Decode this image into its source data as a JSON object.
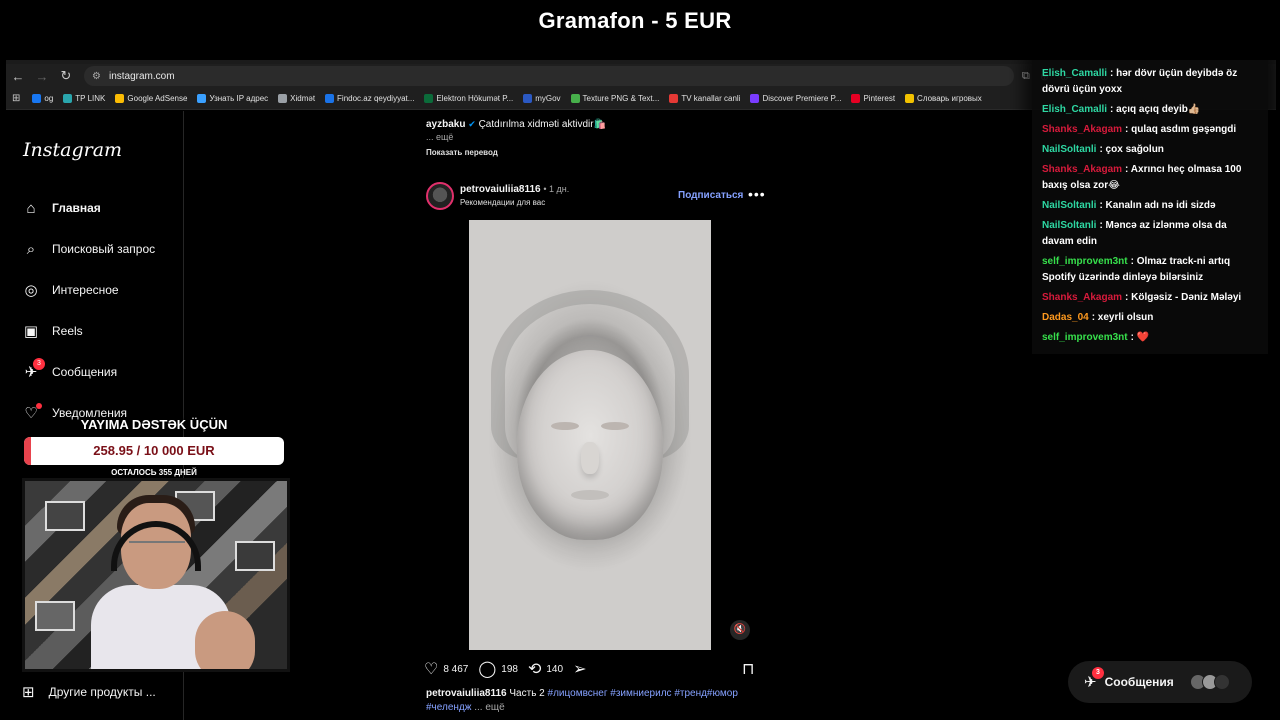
{
  "stream": {
    "title": "Gramafon - 5 EUR"
  },
  "browser": {
    "url": "instagram.com",
    "bookmarks": [
      {
        "label": "og",
        "color": "#1877f2"
      },
      {
        "label": "TP LINK",
        "color": "#2aa6ad"
      },
      {
        "label": "Google AdSense",
        "color": "#fbbc04"
      },
      {
        "label": "Узнать IP адрес",
        "color": "#3aa0ff"
      },
      {
        "label": "Xidmət",
        "color": "#9aa0a6"
      },
      {
        "label": "Findoc.az qeydiyyat...",
        "color": "#1a73e8"
      },
      {
        "label": "Elektron Hökumət P...",
        "color": "#0b6b3a"
      },
      {
        "label": "myGov",
        "color": "#2b59c3"
      },
      {
        "label": "Texture PNG & Text...",
        "color": "#47b04b"
      },
      {
        "label": "TV kanallar canli",
        "color": "#e53935"
      },
      {
        "label": "Discover Premiere P...",
        "color": "#7a3cff"
      },
      {
        "label": "Pinterest",
        "color": "#e60023"
      },
      {
        "label": "Словарь игровых",
        "color": "#f2c200"
      }
    ]
  },
  "sidebar": {
    "logo": "Instagram",
    "items": [
      {
        "label": "Главная",
        "icon": "home-icon",
        "glyph": "⌂"
      },
      {
        "label": "Поисковый запрос",
        "icon": "search-icon",
        "glyph": "⌕"
      },
      {
        "label": "Интересное",
        "icon": "compass-icon",
        "glyph": "◎"
      },
      {
        "label": "Reels",
        "icon": "reels-icon",
        "glyph": "▣"
      },
      {
        "label": "Сообщения",
        "icon": "messenger-icon",
        "glyph": "✈",
        "badge": "3"
      },
      {
        "label": "Уведомления",
        "icon": "heart-icon",
        "glyph": "♡"
      }
    ],
    "other_label": "Другие продукты ..."
  },
  "feed": {
    "prev_post": {
      "user": "ayzbaku",
      "caption": "Çatdırılma xidməti aktivdir🛍️",
      "more": "... ещё",
      "translate": "Показать перевод"
    },
    "post": {
      "user": "petrovaiuliia8116",
      "time": "• 1 дн.",
      "subtitle": "Рекомендации для вас",
      "follow": "Подписаться",
      "likes": "8 467",
      "comments": "198",
      "reposts": "140",
      "caption_user": "petrovaiuliia8116",
      "caption_text": "Часть 2",
      "tags_line1": "#лицомвснег #зимниерилс #тренд#юмор",
      "tags_line2": "#челендж",
      "caption_more": "... ещё"
    }
  },
  "messages_pill": {
    "label": "Сообщения",
    "badge": "3"
  },
  "chat": [
    {
      "name": "Elish_Camalli",
      "color": "#2ed8a3",
      "text": ": hər dövr üçün deyibdə öz dövrü üçün yoxx"
    },
    {
      "name": "Elish_Camalli",
      "color": "#2ed8a3",
      "text": ": açıq açıq deyib👍🏼"
    },
    {
      "name": "Shanks_Akagam",
      "color": "#d81b3c",
      "text": ": qulaq asdım gəşəngdi"
    },
    {
      "name": "NailSoltanli",
      "color": "#2ed8a3",
      "text": ": çox sağolun"
    },
    {
      "name": "Shanks_Akagam",
      "color": "#d81b3c",
      "text": ": Axrıncı heç olmasa 100 baxış olsa zor😂"
    },
    {
      "name": "NailSoltanli",
      "color": "#2ed8a3",
      "text": ": Kanalın adı nə idi sizdə"
    },
    {
      "name": "NailSoltanli",
      "color": "#2ed8a3",
      "text": ": Məncə az izlənmə olsa da davam edin"
    },
    {
      "name": "self_improvem3nt",
      "color": "#37e04c",
      "text": ": Olmaz track-ni artıq Spotify üzərində dinləyə bilərsiniz"
    },
    {
      "name": "Shanks_Akagam",
      "color": "#d81b3c",
      "text": ": Kölgəsiz - Dəniz Məlәyi"
    },
    {
      "name": "Dadas_04",
      "color": "#ff9a1f",
      "text": ": xeyrli olsun"
    },
    {
      "name": "self_improvem3nt",
      "color": "#37e04c",
      "text": ": ❤️"
    }
  ],
  "donation": {
    "title": "YAYIMA DƏSTƏK ÜÇÜN",
    "amount": "258.95 / 10 000 EUR",
    "progress": 0.026,
    "days_left": "ОСТАЛОСЬ 355 ДНЕЙ",
    "fill_color": "#e8434d"
  }
}
